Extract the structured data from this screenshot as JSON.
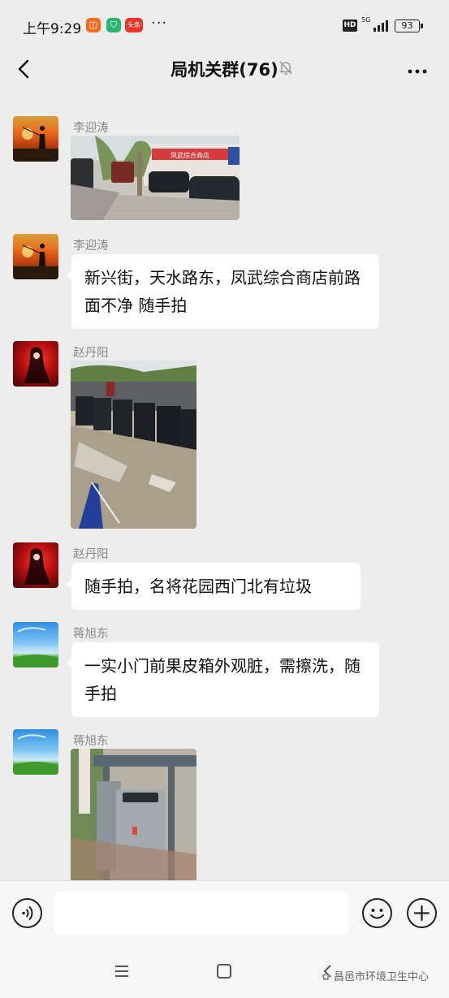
{
  "status_bar": {
    "time": "上午9:29",
    "app_badge": "头条",
    "dots": "···",
    "hd": "HD",
    "network": "5G",
    "battery": "93"
  },
  "header": {
    "title": "局机关群(76)"
  },
  "messages": [
    {
      "sender": "李迎涛",
      "type": "image",
      "image_text": "凤武综合商店"
    },
    {
      "sender": "李迎涛",
      "type": "text",
      "text": "新兴街，天水路东，凤武综合商店前路面不净  随手拍"
    },
    {
      "sender": "赵丹阳",
      "type": "image"
    },
    {
      "sender": "赵丹阳",
      "type": "text",
      "text": "随手拍，名将花园西门北有垃圾"
    },
    {
      "sender": "蒋旭东",
      "type": "text",
      "text": "一实小门前果皮箱外观脏，需擦洗，随手拍"
    },
    {
      "sender": "蒋旭东",
      "type": "image"
    }
  ],
  "input_bar": {
    "placeholder": ""
  },
  "watermark": "昌邑市环境卫生中心",
  "colors": {
    "background": "#ededed",
    "bubble": "#ffffff",
    "sender_name": "#888888"
  }
}
